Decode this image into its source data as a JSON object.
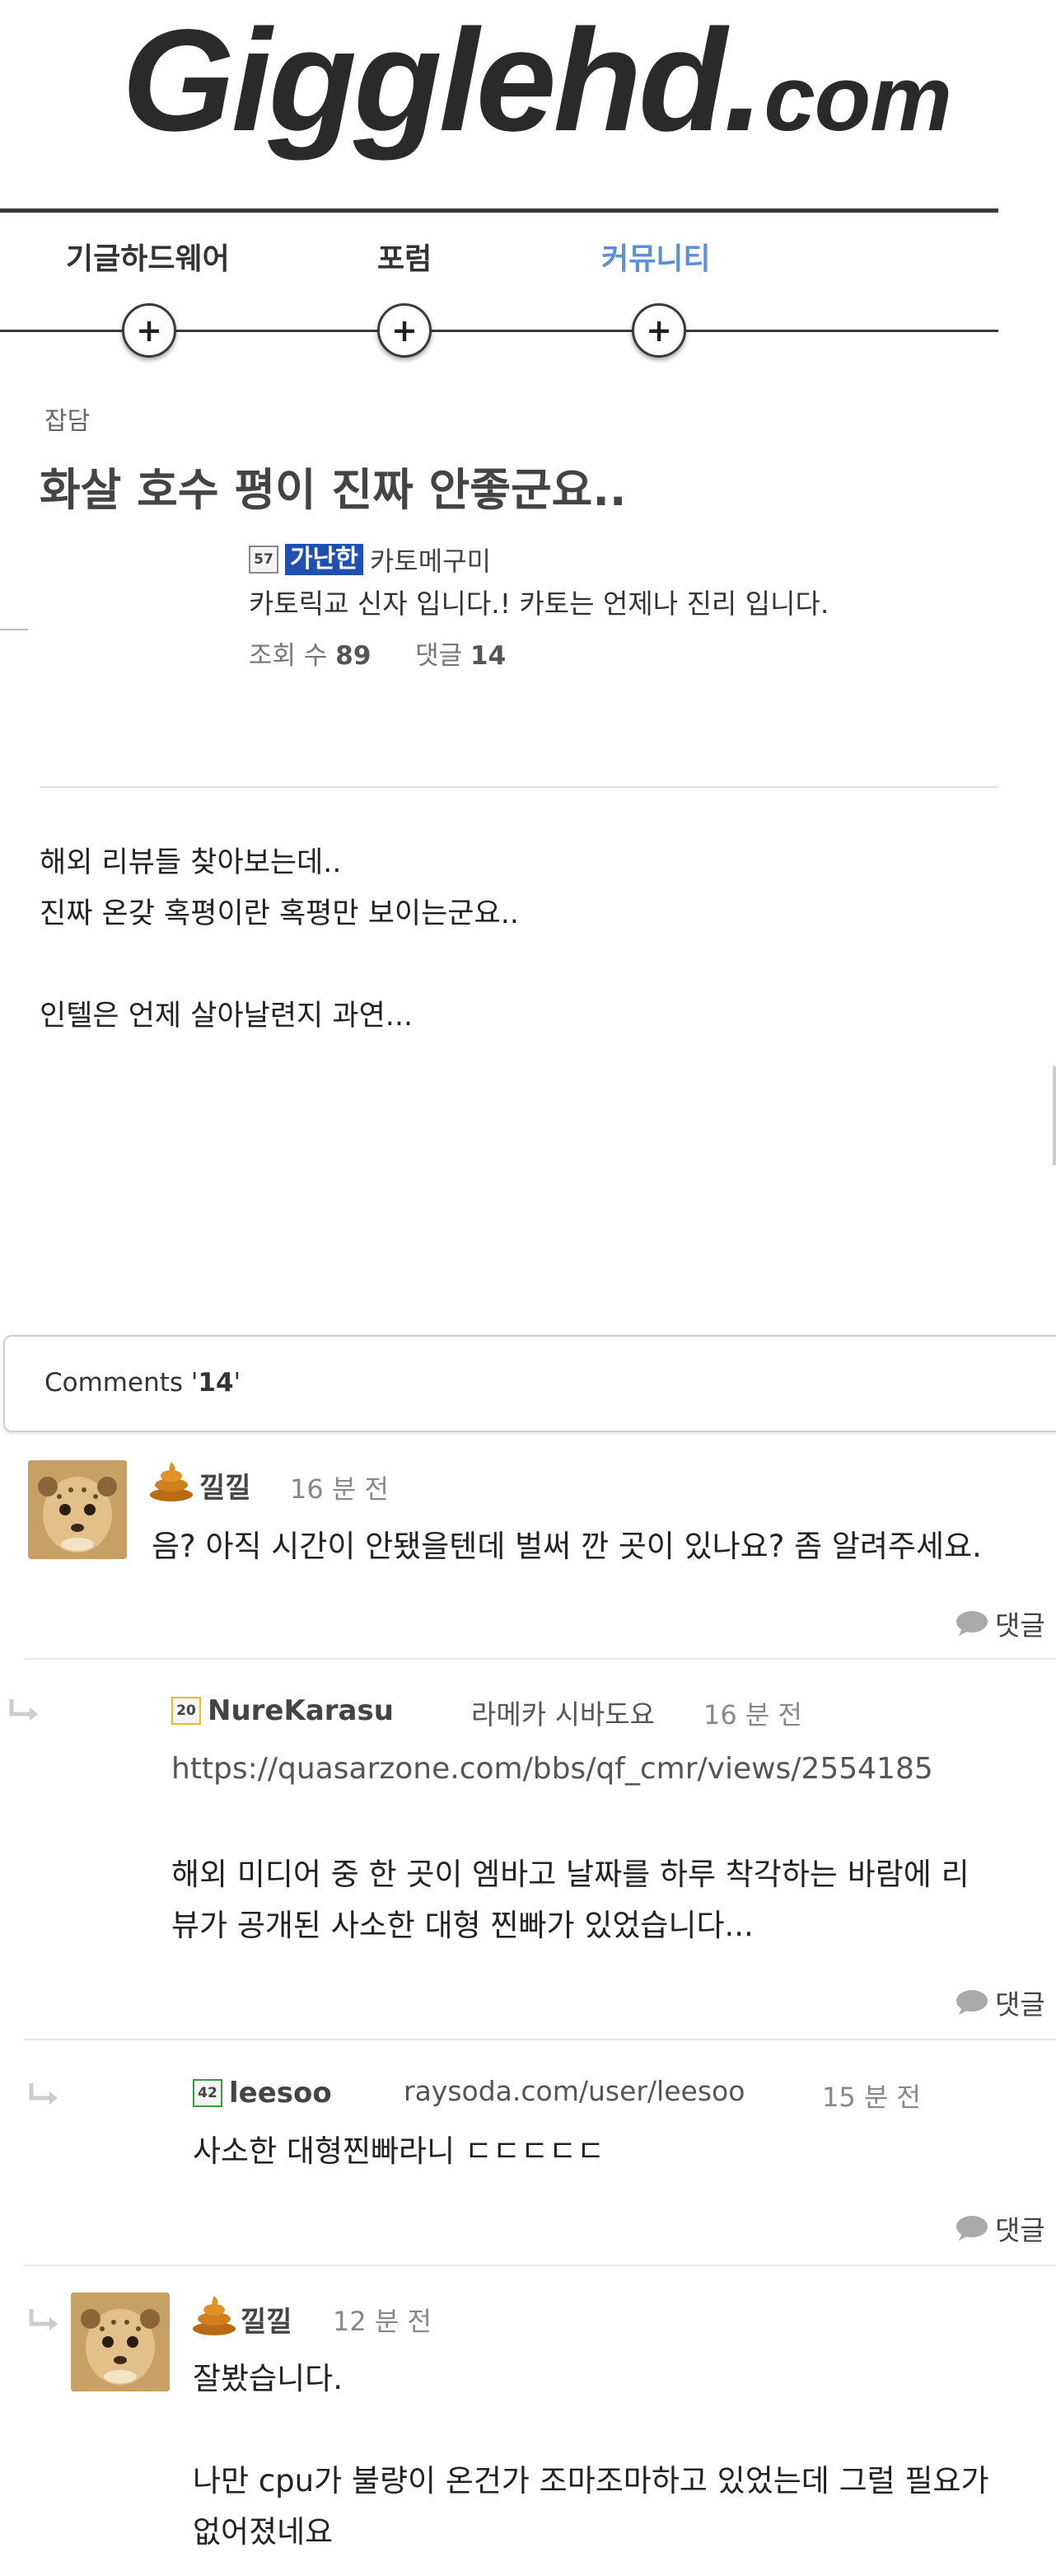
{
  "site": {
    "logo_main": "Gigglehd",
    "logo_dot": ".",
    "logo_tld": "com"
  },
  "nav": [
    {
      "label": "기글하드웨어",
      "active": false
    },
    {
      "label": "포럼",
      "active": false
    },
    {
      "label": "커뮤니티",
      "active": true
    }
  ],
  "nav_plus": "+",
  "post": {
    "category": "잡담",
    "title": "화살 호수 평이 진짜 안좋군요..",
    "author": {
      "level": "57",
      "nick_image_text": "가난한",
      "name": "카토메구미",
      "signature": "카토릭교 신자 입니다.! 카토는 언제나 진리 입니다."
    },
    "views_label": "조회 수",
    "views": "89",
    "comments_label": "댓글",
    "comments_count": "14",
    "body": [
      "해외 리뷰들 찾아보는데..",
      "진짜 온갖 혹평이란 혹평만 보이는군요..",
      "",
      "인텔은 언제 살아날련지 과연..."
    ]
  },
  "comments_header": {
    "prefix": "Comments '",
    "count": "14",
    "suffix": "'"
  },
  "comments": [
    {
      "nick": "낄낄",
      "time": "16 분 전",
      "text": "음? 아직 시간이 안됐을텐데 벌써 깐 곳이 있나요? 좀 알려주세요.",
      "reply_label": "댓글"
    },
    {
      "level": "20",
      "nick": "NureKarasu",
      "signature": "라메카 시바도요",
      "time": "16 분 전",
      "url": "https://quasarzone.com/bbs/qf_cmr/views/2554185",
      "text_lines": [
        "해외 미디어 중 한 곳이 엠바고 날짜를 하루 착각하는 바람에 리",
        "뷰가 공개된 사소한 대형 찐빠가 있었습니다..."
      ],
      "reply_label": "댓글"
    },
    {
      "level": "42",
      "nick": "leesoo",
      "signature": "raysoda.com/user/leesoo",
      "time": "15 분 전",
      "text": "사소한 대형찐빠라니 ㄷㄷㄷㄷㄷ",
      "reply_label": "댓글"
    },
    {
      "nick": "낄낄",
      "time": "12 분 전",
      "text_lines": [
        "잘봤습니다.",
        "",
        "나만 cpu가 불량이 온건가 조마조마하고 있었는데 그럴 필요가",
        "없어졌네요"
      ]
    }
  ],
  "colors": {
    "accent": "#5b8fd6",
    "nick_badge_bg": "#1f4fb0",
    "divider": "#3a3a3a"
  },
  "icons": {
    "nav_button": "plus-circle-icon",
    "reply": "speech-bubble-icon",
    "nested_reply": "reply-arrow-icon",
    "level_badge": "level-badge-icon",
    "poop": "poop-icon"
  }
}
